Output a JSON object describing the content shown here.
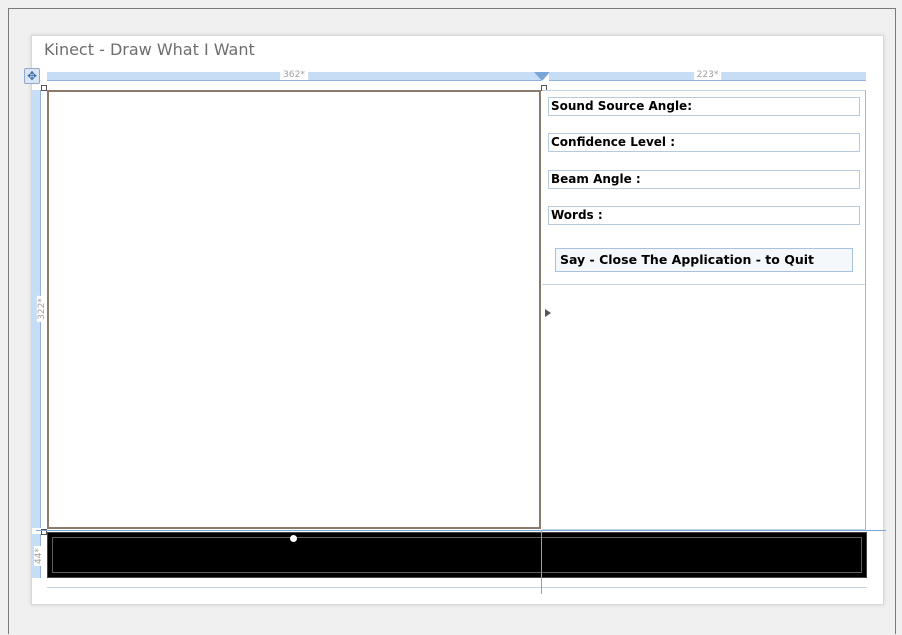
{
  "window": {
    "title": "Kinect - Draw What I Want"
  },
  "designer": {
    "columns": [
      {
        "label": "362*"
      },
      {
        "label": "223*"
      }
    ],
    "rows": [
      {
        "label": "322*"
      },
      {
        "label": "44*"
      }
    ]
  },
  "panel": {
    "fields": [
      {
        "label": "Sound Source Angle:"
      },
      {
        "label": "Confidence Level :"
      },
      {
        "label": "Beam Angle :"
      },
      {
        "label": "Words :"
      }
    ],
    "quit_label": "Say - Close The Application - to Quit"
  },
  "icons": {
    "move": "move-icon",
    "expand": "triangle-right-icon"
  }
}
